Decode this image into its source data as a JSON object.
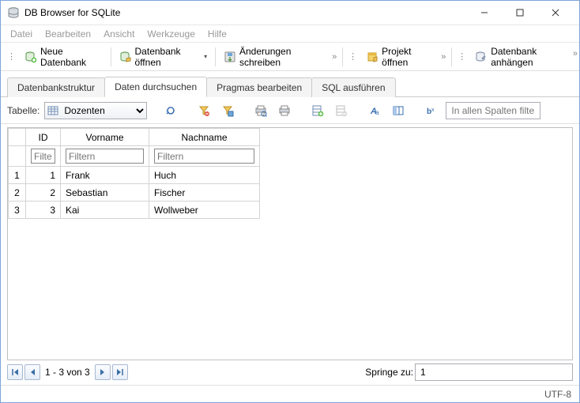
{
  "window": {
    "title": "DB Browser for SQLite"
  },
  "menu": {
    "datei": "Datei",
    "bearbeiten": "Bearbeiten",
    "ansicht": "Ansicht",
    "werkzeuge": "Werkzeuge",
    "hilfe": "Hilfe"
  },
  "toolbar": {
    "new_db": "Neue Datenbank",
    "open_db": "Datenbank öffnen",
    "write_changes": "Änderungen schreiben",
    "open_project": "Projekt öffnen",
    "attach_db": "Datenbank anhängen"
  },
  "tabs": {
    "structure": "Datenbankstruktur",
    "browse": "Daten durchsuchen",
    "pragmas": "Pragmas bearbeiten",
    "sql": "SQL ausführen"
  },
  "browse": {
    "table_label": "Tabelle:",
    "table_selected": "Dozenten",
    "filter_all_placeholder": "In allen Spalten filtern",
    "columns": {
      "id": "ID",
      "vorname": "Vorname",
      "nachname": "Nachname"
    },
    "filter_placeholder": "Filtern",
    "rows": [
      {
        "n": "1",
        "id": "1",
        "vorname": "Frank",
        "nachname": "Huch"
      },
      {
        "n": "2",
        "id": "2",
        "vorname": "Sebastian",
        "nachname": "Fischer"
      },
      {
        "n": "3",
        "id": "3",
        "vorname": "Kai",
        "nachname": "Wollweber"
      }
    ]
  },
  "footer": {
    "range": "1 - 3 von 3",
    "jump_label": "Springe zu:",
    "jump_value": "1"
  },
  "status": {
    "encoding": "UTF-8"
  }
}
